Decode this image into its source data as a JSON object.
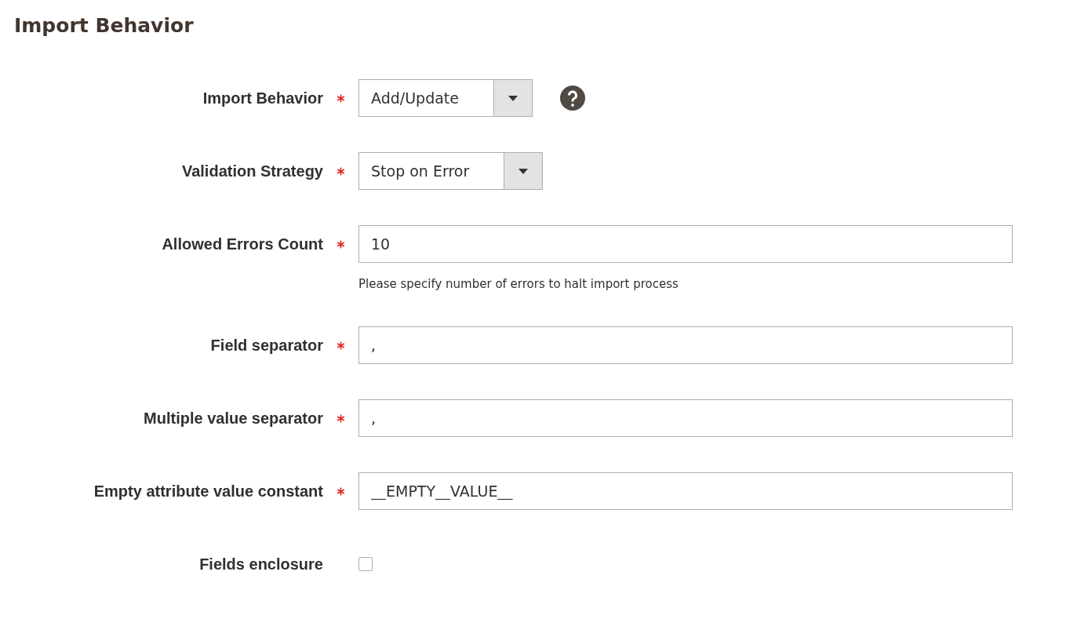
{
  "section_title": "Import Behavior",
  "fields": [
    {
      "kind": "select",
      "label": "Import Behavior",
      "required": true,
      "value": "Add/Update",
      "help": true
    },
    {
      "kind": "select",
      "label": "Validation Strategy",
      "required": true,
      "value": "Stop on Error",
      "help": false
    },
    {
      "kind": "text",
      "label": "Allowed Errors Count",
      "required": true,
      "value": "10",
      "note": "Please specify number of errors to halt import process"
    },
    {
      "kind": "text",
      "label": "Field separator",
      "required": true,
      "value": ","
    },
    {
      "kind": "text",
      "label": "Multiple value separator",
      "required": true,
      "value": ","
    },
    {
      "kind": "text",
      "label": "Empty attribute value constant",
      "required": true,
      "value": "__EMPTY__VALUE__"
    },
    {
      "kind": "checkbox",
      "label": "Fields enclosure",
      "required": false,
      "checked": false
    }
  ]
}
